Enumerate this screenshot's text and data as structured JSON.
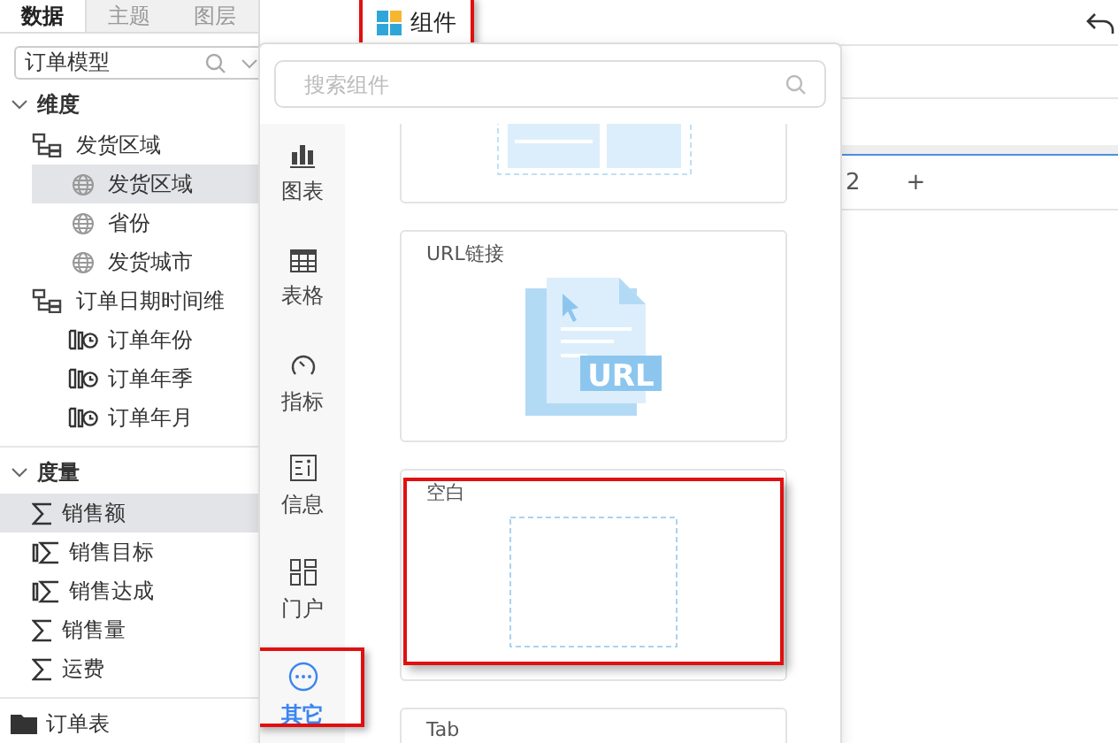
{
  "sidebar": {
    "tabs": [
      {
        "label": "数据",
        "selected": true
      },
      {
        "label": "主题",
        "selected": false
      },
      {
        "label": "图层",
        "selected": false
      }
    ],
    "model_select": {
      "value": "订单模型"
    },
    "tree": [
      {
        "label": "维度",
        "kind": "section",
        "selected": false,
        "children": [
          {
            "label": "发货区域",
            "kind": "hierarchy",
            "selected": false,
            "children": [
              {
                "label": "发货区域",
                "kind": "geo",
                "selected": true
              },
              {
                "label": "省份",
                "kind": "geo",
                "selected": false
              },
              {
                "label": "发货城市",
                "kind": "geo",
                "selected": false
              }
            ]
          },
          {
            "label": "订单日期时间维",
            "kind": "hierarchy",
            "selected": false,
            "children": [
              {
                "label": "订单年份",
                "kind": "date",
                "selected": false
              },
              {
                "label": "订单年季",
                "kind": "date",
                "selected": false
              },
              {
                "label": "订单年月",
                "kind": "date",
                "selected": false
              }
            ]
          }
        ]
      },
      {
        "label": "度量",
        "kind": "section",
        "selected": false,
        "children": [
          {
            "label": "销售额",
            "kind": "measure",
            "selected": true
          },
          {
            "label": "销售目标",
            "kind": "calc",
            "selected": false
          },
          {
            "label": "销售达成",
            "kind": "calc",
            "selected": false
          },
          {
            "label": "销售量",
            "kind": "measure",
            "selected": false
          },
          {
            "label": "运费",
            "kind": "measure",
            "selected": false
          }
        ]
      },
      {
        "label": "订单表",
        "kind": "table",
        "selected": false
      }
    ]
  },
  "toolbar": {
    "component_button": {
      "label": "组件",
      "highlighted": true
    }
  },
  "workspace": {
    "page_tab": "2",
    "add_tab": "+"
  },
  "component_panel": {
    "search": {
      "placeholder": "搜索组件"
    },
    "categories": [
      {
        "label": "图表",
        "kind": "chart",
        "selected": false,
        "highlighted": false
      },
      {
        "label": "表格",
        "kind": "table",
        "selected": false,
        "highlighted": false
      },
      {
        "label": "指标",
        "kind": "gauge",
        "selected": false,
        "highlighted": false
      },
      {
        "label": "信息",
        "kind": "info",
        "selected": false,
        "highlighted": false
      },
      {
        "label": "门户",
        "kind": "portal",
        "selected": false,
        "highlighted": false
      },
      {
        "label": "其它",
        "kind": "more",
        "selected": true,
        "highlighted": true
      }
    ],
    "cards": [
      {
        "kind": "media",
        "highlighted": false
      },
      {
        "kind": "url",
        "title": "URL链接",
        "icon_text": "URL",
        "highlighted": false
      },
      {
        "kind": "blank",
        "title": "空白",
        "highlighted": true
      },
      {
        "kind": "tab",
        "title": "Tab",
        "highlighted": false
      }
    ]
  }
}
